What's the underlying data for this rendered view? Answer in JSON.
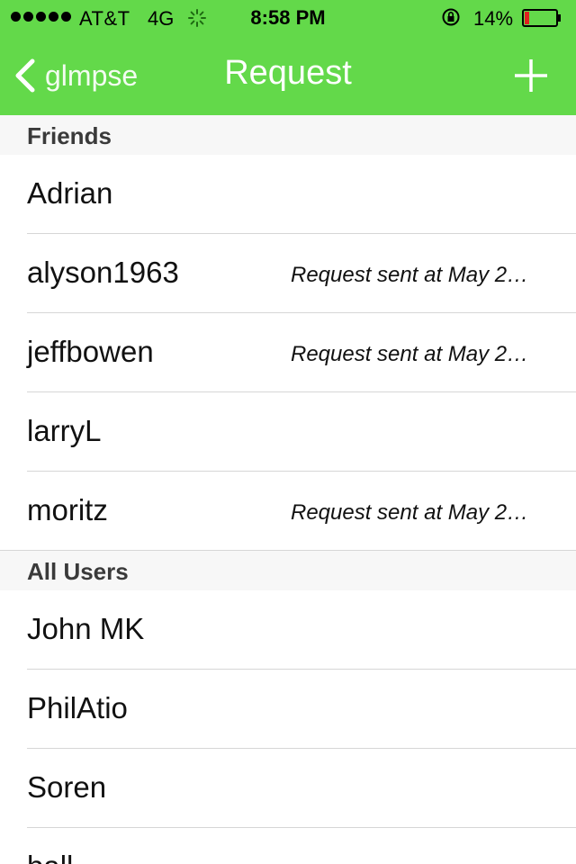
{
  "status_bar": {
    "carrier": "AT&T",
    "network": "4G",
    "time": "8:58 PM",
    "battery": "14%",
    "battery_level": 0.14,
    "signal_bars": 5
  },
  "nav": {
    "back_label": "glmpse",
    "title": "Request"
  },
  "sections": {
    "friends": {
      "header": "Friends",
      "rows": [
        {
          "name": "Adrian",
          "detail": ""
        },
        {
          "name": "alyson1963",
          "detail": "Request sent at May 2…"
        },
        {
          "name": "jeffbowen",
          "detail": "Request sent at May 2…"
        },
        {
          "name": "larryL",
          "detail": ""
        },
        {
          "name": "moritz",
          "detail": "Request sent at May 2…"
        }
      ]
    },
    "all_users": {
      "header": "All Users",
      "rows": [
        {
          "name": "John MK"
        },
        {
          "name": "PhilAtio"
        },
        {
          "name": "Soren"
        },
        {
          "name": "ball"
        }
      ]
    }
  },
  "colors": {
    "accent": "#63d94a",
    "battery_low": "#e02020"
  }
}
